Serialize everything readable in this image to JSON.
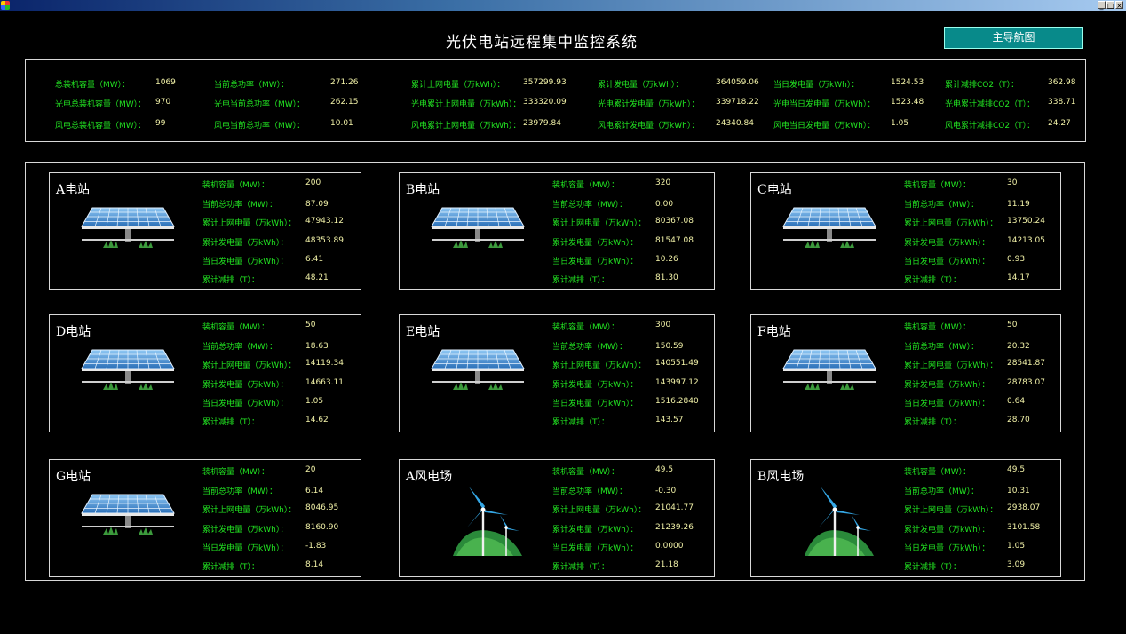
{
  "window": {
    "min": "_",
    "max": "□",
    "close": "×"
  },
  "title": "光伏电站远程集中监控系统",
  "nav_button": "主导航图",
  "summary": [
    {
      "label": "总装机容量（MW）：",
      "value": "1069"
    },
    {
      "label": "当前总功率（MW）：",
      "value": "271.26"
    },
    {
      "label": "累计上网电量（万kWh）：",
      "value": "357299.93"
    },
    {
      "label": "累计发电量（万kWh）：",
      "value": "364059.06"
    },
    {
      "label": "当日发电量（万kWh）：",
      "value": "1524.53"
    },
    {
      "label": "累计减排CO2（T）：",
      "value": "362.98"
    },
    {
      "label": "光电总装机容量（MW）：",
      "value": "970"
    },
    {
      "label": "光电当前总功率（MW）：",
      "value": "262.15"
    },
    {
      "label": "光电累计上网电量（万kWh）：",
      "value": "333320.09"
    },
    {
      "label": "光电累计发电量（万kWh）：",
      "value": "339718.22"
    },
    {
      "label": "光电当日发电量（万kWh）：",
      "value": "1523.48"
    },
    {
      "label": "光电累计减排CO2（T）：",
      "value": "338.71"
    },
    {
      "label": "风电总装机容量（MW）：",
      "value": "99"
    },
    {
      "label": "风电当前总功率（MW）：",
      "value": "10.01"
    },
    {
      "label": "风电累计上网电量（万kWh）：",
      "value": "23979.84"
    },
    {
      "label": "风电累计发电量（万kWh）：",
      "value": "24340.84"
    },
    {
      "label": "风电当日发电量（万kWh）：",
      "value": "1.05"
    },
    {
      "label": "风电累计减排CO2（T）：",
      "value": "24.27"
    }
  ],
  "field_labels": [
    "装机容量（MW）：",
    "当前总功率（MW）：",
    "累计上网电量（万kWh）：",
    "累计发电量（万kWh）：",
    "当日发电量（万kWh）：",
    "累计减排（T）："
  ],
  "stations": [
    {
      "name": "A电站",
      "type": "solar",
      "values": [
        "200",
        "87.09",
        "47943.12",
        "48353.89",
        "6.41",
        "48.21"
      ]
    },
    {
      "name": "B电站",
      "type": "solar",
      "values": [
        "320",
        "0.00",
        "80367.08",
        "81547.08",
        "10.26",
        "81.30"
      ]
    },
    {
      "name": "C电站",
      "type": "solar",
      "values": [
        "30",
        "11.19",
        "13750.24",
        "14213.05",
        "0.93",
        "14.17"
      ]
    },
    {
      "name": "D电站",
      "type": "solar",
      "values": [
        "50",
        "18.63",
        "14119.34",
        "14663.11",
        "1.05",
        "14.62"
      ]
    },
    {
      "name": "E电站",
      "type": "solar",
      "values": [
        "300",
        "150.59",
        "140551.49",
        "143997.12",
        "1516.2840",
        "143.57"
      ]
    },
    {
      "name": "F电站",
      "type": "solar",
      "values": [
        "50",
        "20.32",
        "28541.87",
        "28783.07",
        "0.64",
        "28.70"
      ]
    },
    {
      "name": "G电站",
      "type": "solar",
      "values": [
        "20",
        "6.14",
        "8046.95",
        "8160.90",
        "-1.83",
        "8.14"
      ]
    },
    {
      "name": "A风电场",
      "type": "wind",
      "values": [
        "49.5",
        "-0.30",
        "21041.77",
        "21239.26",
        "0.0000",
        "21.18"
      ]
    },
    {
      "name": "B风电场",
      "type": "wind",
      "values": [
        "49.5",
        "10.31",
        "2938.07",
        "3101.58",
        "1.05",
        "3.09"
      ]
    }
  ],
  "colors": {
    "label": "#22e622",
    "value": "#f2f2a8",
    "nav": "#088a8a",
    "background": "#000000"
  },
  "icons": {
    "solar": "solar-panel-icon",
    "wind": "wind-turbine-icon"
  }
}
